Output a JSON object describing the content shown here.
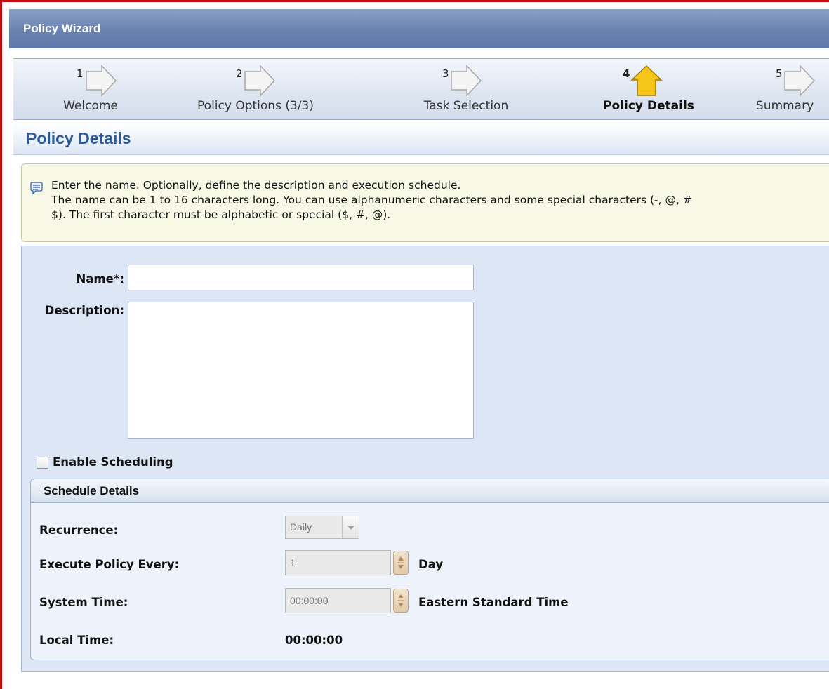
{
  "window": {
    "title": "Policy Wizard"
  },
  "steps": [
    {
      "number": "1",
      "label": "Welcome",
      "state": "inactive"
    },
    {
      "number": "2",
      "label": "Policy Options (3/3)",
      "state": "inactive"
    },
    {
      "number": "3",
      "label": "Task Selection",
      "state": "inactive"
    },
    {
      "number": "4",
      "label": "Policy Details",
      "state": "active"
    },
    {
      "number": "5",
      "label": "Summary",
      "state": "inactive"
    }
  ],
  "section": {
    "title": "Policy Details"
  },
  "info": {
    "line1": "Enter the name. Optionally, define the description and execution schedule.",
    "line2": "The name can be 1 to 16 characters long. You can use alphanumeric characters and some special characters (-, @, #",
    "line3": "$). The first character must be alphabetic or special ($, #, @)."
  },
  "form": {
    "name_label": "Name*:",
    "name_value": "",
    "description_label": "Description:",
    "description_value": "",
    "enable_scheduling_label": "Enable Scheduling",
    "enable_scheduling_checked": false
  },
  "schedule": {
    "title": "Schedule Details",
    "recurrence_label": "Recurrence:",
    "recurrence_value": "Daily",
    "execute_label": "Execute Policy Every:",
    "execute_value": "1",
    "execute_unit": "Day",
    "system_time_label": "System Time:",
    "system_time_value": "00:00:00",
    "system_time_zone": "Eastern Standard Time",
    "local_time_label": "Local Time:",
    "local_time_value": "00:00:00"
  },
  "colors": {
    "active_step": "#f5c518",
    "inactive_step": "#f4f4f4",
    "title_bar": "#6a82b0",
    "section_title": "#2b5a98"
  }
}
